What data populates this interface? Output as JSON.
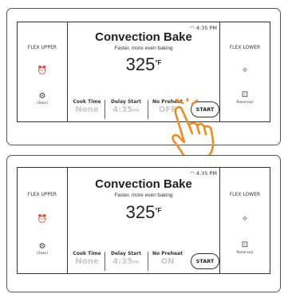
{
  "panels": [
    {
      "status_time": "4:35 PM",
      "left": {
        "flex_upper": "FLEX UPPER",
        "timer_icon": "alarm-clock-icon",
        "settings_icon": "gear-icon",
        "settings_sub": "(3sec)"
      },
      "right": {
        "flex_lower": "FLEX LOWER",
        "light_icon": "light-icon",
        "reservoir_icon": "reservoir-icon",
        "reservoir": "Reservoir"
      },
      "title": "Convection Bake",
      "subtitle": "Faster, more even baking",
      "temperature": "325",
      "unit": "°F",
      "cook_time_label": "Cook Time",
      "cook_time_value": "None",
      "delay_start_label": "Delay Start",
      "delay_start_value": "4:35",
      "delay_start_suffix": "PM",
      "no_preheat_label": "No Preheat",
      "no_preheat_value": "OFF",
      "start_label": "START",
      "touch_indicator": "hand-tap-icon"
    },
    {
      "status_time": "4:35 PM",
      "left": {
        "flex_upper": "FLEX UPPER",
        "timer_icon": "alarm-clock-icon",
        "settings_icon": "gear-icon",
        "settings_sub": "(3sec)"
      },
      "right": {
        "flex_lower": "FLEX LOWER",
        "light_icon": "light-icon",
        "reservoir_icon": "reservoir-icon",
        "reservoir": "Reservoir"
      },
      "title": "Convection Bake",
      "subtitle": "Faster, more even baking",
      "temperature": "325",
      "unit": "°F",
      "cook_time_label": "Cook Time",
      "cook_time_value": "None",
      "delay_start_label": "Delay Start",
      "delay_start_value": "4:35",
      "delay_start_suffix": "PM",
      "no_preheat_label": "No Preheat",
      "no_preheat_value": "ON",
      "start_label": "START"
    }
  ],
  "colors": {
    "border": "#333333",
    "muted_value": "#c8c8c8",
    "hand": "#f28a1e"
  }
}
